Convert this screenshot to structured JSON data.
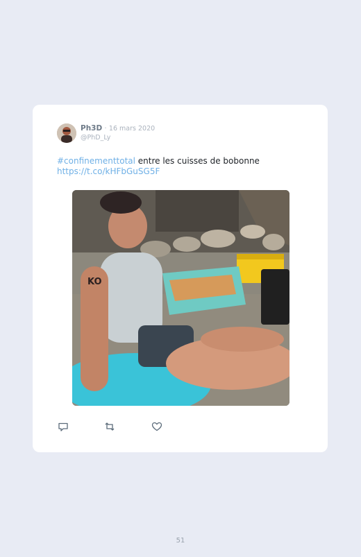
{
  "tweet": {
    "author_name": "Ph3D",
    "separator": "·",
    "date": "16 mars 2020",
    "handle": "@PhD_Ly",
    "hashtag": "#confinementtotal",
    "body": " entre les cuisses de bobonne",
    "link": "https://t.co/kHFbGuSG5F"
  },
  "media": {
    "tattoo_text": "KO"
  },
  "actions": {
    "reply_icon": "speech-bubble-icon",
    "retweet_icon": "retweet-arrows-icon",
    "like_icon": "heart-icon"
  },
  "colors": {
    "background": "#e8ebf4",
    "card": "#ffffff",
    "link": "#6fb0e6",
    "action_icon": "#5b6b7a"
  },
  "page": {
    "number": "51"
  }
}
